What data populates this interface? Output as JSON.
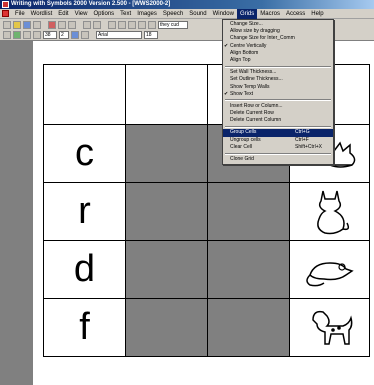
{
  "window": {
    "title": "Writing with Symbols 2000 Version 2.500 - [WWS2000-2]"
  },
  "menubar": {
    "items": [
      "File",
      "Wordlist",
      "Edit",
      "View",
      "Options",
      "Text",
      "Images",
      "Speech",
      "Sound",
      "Window",
      "Grids",
      "Macros",
      "Access",
      "Help"
    ],
    "active": "Grids"
  },
  "toolbar": {
    "style_field": "they cud",
    "size_a": "38",
    "size_b": "2",
    "font_name": "Arial",
    "font_size": "18"
  },
  "grid": {
    "rows": [
      [
        "",
        "",
        "",
        ""
      ],
      [
        "c",
        "",
        "",
        "cat-picture"
      ],
      [
        "r",
        "",
        "",
        "cat-picture"
      ],
      [
        "d",
        "",
        "",
        "rat-picture"
      ],
      [
        "f",
        "",
        "",
        "dog-picture"
      ]
    ]
  },
  "grids_menu": {
    "items": [
      {
        "label": "Change Size...",
        "shortcut": "",
        "checked": false
      },
      {
        "label": "Allow size by dragging",
        "shortcut": "",
        "checked": false
      },
      {
        "label": "Change Size for Inter_Comm",
        "shortcut": "",
        "checked": false
      },
      {
        "label": "Centre Vertically",
        "shortcut": "",
        "checked": true
      },
      {
        "label": "Align Bottom",
        "shortcut": "",
        "checked": false
      },
      {
        "label": "Align Top",
        "shortcut": "",
        "checked": false
      },
      {
        "sep": true
      },
      {
        "label": "Set Wall Thickness...",
        "shortcut": "",
        "checked": false
      },
      {
        "label": "Set Outline Thickness...",
        "shortcut": "",
        "checked": false
      },
      {
        "label": "Show Temp Walls",
        "shortcut": "",
        "checked": false
      },
      {
        "label": "Show Text",
        "shortcut": "",
        "checked": true
      },
      {
        "sep": true
      },
      {
        "label": "Insert Row or Column...",
        "shortcut": "",
        "checked": false
      },
      {
        "label": "Delete Current Row",
        "shortcut": "",
        "checked": false
      },
      {
        "label": "Delete Current Column",
        "shortcut": "",
        "checked": false
      },
      {
        "sep": true
      },
      {
        "label": "Group Cells",
        "shortcut": "Ctrl+G",
        "checked": false,
        "highlighted": true
      },
      {
        "label": "Ungroup cells",
        "shortcut": "Ctrl+F",
        "checked": false
      },
      {
        "label": "Clear Cell",
        "shortcut": "Shift+Ctrl+X",
        "checked": false
      },
      {
        "sep": true
      },
      {
        "label": "Clone Grid",
        "shortcut": "",
        "checked": false
      }
    ]
  }
}
